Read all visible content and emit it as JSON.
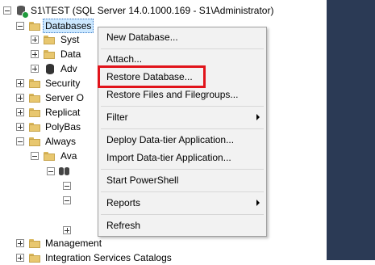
{
  "tree": {
    "server_label": "S1\\TEST (SQL Server 14.0.1000.169 - S1\\Administrator)",
    "databases_label": "Databases",
    "db_children": [
      "Syst",
      "Data",
      "Adv"
    ],
    "nodes": [
      "Security",
      "Server O",
      "Replicat",
      "PolyBas",
      "Always"
    ],
    "ag_label": "Ava",
    "bottom_nodes": [
      "Management",
      "Integration Services Catalogs"
    ]
  },
  "context_menu": {
    "items": [
      {
        "label": "New Database..."
      },
      {
        "label": "Attach..."
      },
      {
        "label": "Restore Database..."
      },
      {
        "label": "Restore Files and Filegroups..."
      },
      {
        "label": "Filter"
      },
      {
        "label": "Deploy Data-tier Application..."
      },
      {
        "label": "Import Data-tier Application..."
      },
      {
        "label": "Start PowerShell"
      },
      {
        "label": "Reports"
      },
      {
        "label": "Refresh"
      }
    ]
  },
  "colors": {
    "highlight_border": "#e1141b",
    "selection_bg": "#cce8ff",
    "side_panel": "#2b3a55"
  }
}
